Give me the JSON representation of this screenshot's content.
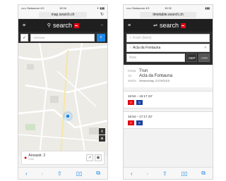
{
  "left": {
    "status": {
      "carrier": "••••• Swisscom 4G",
      "time": "15:34",
      "battery": "✦ ▮▮▮"
    },
    "url": "map.search.ch",
    "brand": "search",
    "search_placeholder": "Adresse",
    "location": {
      "address": "Arosastr. 2",
      "sub": "Chur"
    },
    "icons": {
      "reload": "reload-icon",
      "locate": "locate-arrow-icon",
      "search": "search-icon"
    }
  },
  "right": {
    "status": {
      "carrier": "••••• Swisscom 4G",
      "time": "15:32",
      "battery": "▮▮▮"
    },
    "url": "timetable.search.ch",
    "brand": "search",
    "from_placeholder": "From (here)",
    "to_value": "Acla da Fontauna",
    "time_placeholder": "Now",
    "dep_label": "DEP",
    "arr_label": "ARR",
    "route": {
      "from_label": "FROM",
      "from_value": "Trun",
      "to_label": "TO",
      "to_value": "Acla da Fontauna",
      "when_label": "WHEN",
      "when_value": "Wednesday, 07/29/2015"
    },
    "connections": [
      {
        "time": "15:54 – 16:17  23'",
        "chips": [
          "R",
          "B"
        ]
      },
      {
        "time": "16:54 – 17:17  23'",
        "chips": [
          "R",
          "B"
        ]
      }
    ]
  },
  "colors": {
    "accent_red": "#e30613",
    "accent_blue": "#1e88e5",
    "dark": "#1f1f1f"
  }
}
